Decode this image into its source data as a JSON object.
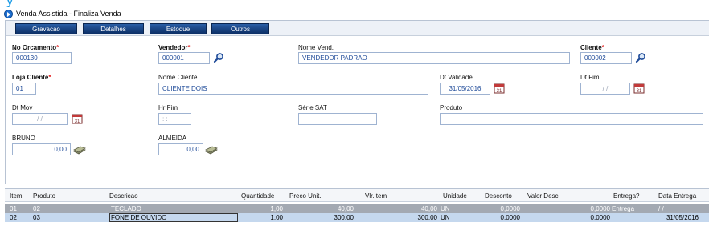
{
  "title": "Venda Assistida - Finaliza Venda",
  "tabs": [
    "Gravacao",
    "Detalhes",
    "Estoque",
    "Outros"
  ],
  "fields": {
    "orcamento": {
      "label": "No Orcamento",
      "value": "000130"
    },
    "vendedor": {
      "label": "Vendedor",
      "value": "000001"
    },
    "nome_vend": {
      "label": "Nome Vend.",
      "value": "VENDEDOR PADRAO"
    },
    "cliente": {
      "label": "Cliente",
      "value": "000002"
    },
    "loja": {
      "label": "Loja Cliente",
      "value": "01"
    },
    "nome_cliente": {
      "label": "Nome Cliente",
      "value": "CLIENTE DOIS"
    },
    "dt_validade": {
      "label": "Dt.Validade",
      "value": "31/05/2016"
    },
    "dt_fim": {
      "label": "Dt Fim",
      "value": "/ /"
    },
    "dt_mov": {
      "label": "Dt Mov",
      "value": "/ /"
    },
    "hr_fim": {
      "label": "Hr Fim",
      "value": ": :"
    },
    "serie_sat": {
      "label": "Série SAT",
      "value": ""
    },
    "produto": {
      "label": "Produto",
      "value": ""
    },
    "bruno": {
      "label": "BRUNO",
      "value": "0,00"
    },
    "almeida": {
      "label": "ALMEIDA",
      "value": "0,00"
    },
    "required_mark": "*"
  },
  "grid": {
    "columns": [
      "Item",
      "Produto",
      "Descricao",
      "Quantidade",
      "Preco Unit.",
      "Vlr.Item",
      "Unidade",
      "Desconto",
      "Valor Desc",
      "Entrega?",
      "Data Entrega"
    ],
    "rows": [
      {
        "item": "01",
        "produto": "02",
        "descricao": "TECLADO",
        "quantidade": "1,00",
        "preco": "40,00",
        "vlr_item": "40,00",
        "unidade": "UN",
        "desconto": "0,0000",
        "valor_desc": "0,0000",
        "entrega": "Entrega",
        "data_entrega": "/ /"
      },
      {
        "item": "02",
        "produto": "03",
        "descricao": "FONE DE OUVIDO",
        "quantidade": "1,00",
        "preco": "300,00",
        "vlr_item": "300,00",
        "unidade": "UN",
        "desconto": "0,0000",
        "valor_desc": "0,0000",
        "entrega": "",
        "data_entrega": "31/05/2016"
      }
    ]
  },
  "colors": {
    "accent": "#0f3a7a",
    "selected_row": "#c5d8ee",
    "inactive_row": "#a3a9b2",
    "required": "#e21d1d"
  }
}
